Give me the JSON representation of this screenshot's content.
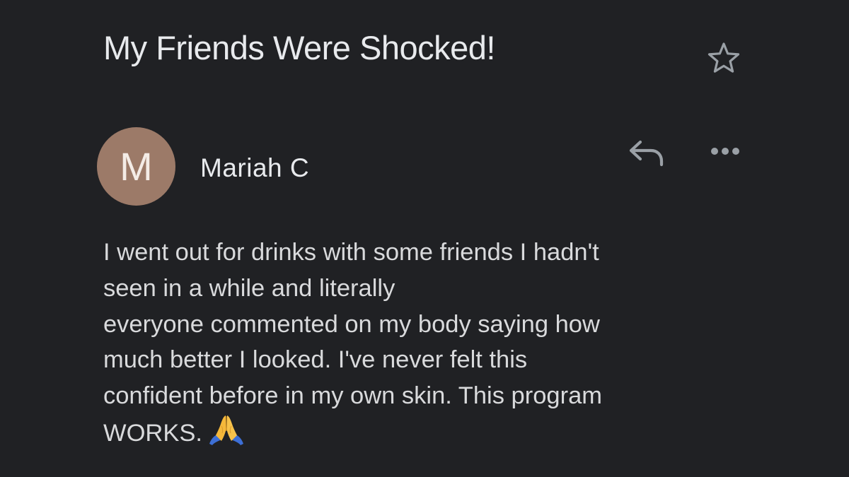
{
  "email": {
    "subject": "My Friends Were Shocked!",
    "sender": {
      "avatar_initial": "M",
      "avatar_color": "#9c7a68",
      "name": "Mariah C"
    },
    "body_lines": [
      "I went out for drinks with some friends I hadn't",
      "seen in a while and literally",
      "everyone commented on my body saying how",
      "much better I looked. I've never felt this",
      "confident before in my own skin. This program",
      "WORKS."
    ],
    "emoji": "folded-hands-emoji"
  },
  "icons": {
    "star": "star-outline-icon",
    "reply": "reply-icon",
    "more": "more-horizontal-icon"
  },
  "colors": {
    "background": "#202124",
    "text": "#e8eaed",
    "icon": "#9aa0a6"
  }
}
